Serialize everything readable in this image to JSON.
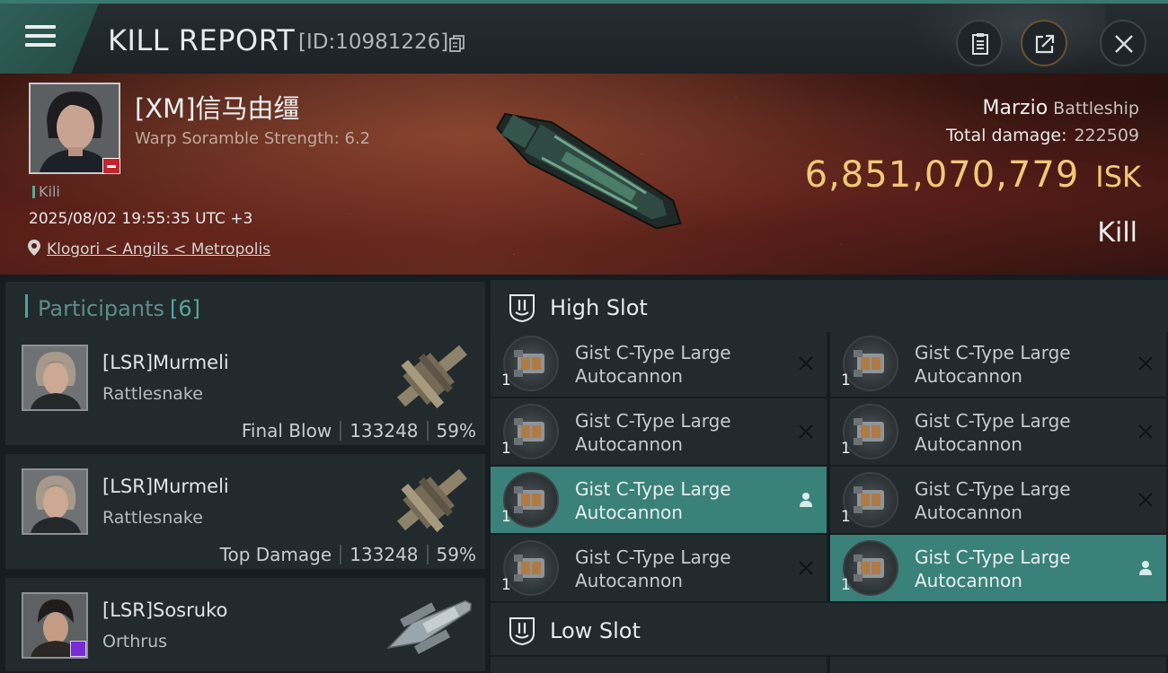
{
  "header": {
    "title": "KILL REPORT",
    "report_id": "[ID:10981226]",
    "icons": {
      "menu": "hamburger-menu-icon",
      "copy": "copy-icon",
      "report": "clipboard-icon",
      "share": "share-icon",
      "close": "close-icon"
    }
  },
  "victim": {
    "name": "[XM]信马由缰",
    "scramble": "Warp Soramble Strength: 6.2",
    "kill_tag": "Kili",
    "datetime": "2025/08/02 19:55:35 UTC +3",
    "location": "Klogori < Angils < Metropolis",
    "ship_name": "Marzio",
    "ship_class": "Battleship",
    "total_damage_label": "Total damage:",
    "total_damage": "222509",
    "isk_value": "6,851,070,779",
    "isk_unit": "ISK",
    "result": "Kill"
  },
  "participants": {
    "label": "Participants",
    "count": "[6]",
    "items": [
      {
        "name": "[LSR]Murmeli",
        "ship": "Rattlesnake",
        "role": "Final Blow",
        "damage": "133248",
        "percent": "59%"
      },
      {
        "name": "[LSR]Murmeli",
        "ship": "Rattlesnake",
        "role": "Top Damage",
        "damage": "133248",
        "percent": "59%"
      },
      {
        "name": "[LSR]Sosruko",
        "ship": "Orthrus",
        "role": "",
        "damage": "",
        "percent": ""
      }
    ]
  },
  "fitting": {
    "high_slot_label": "High Slot",
    "low_slot_label": "Low Slot",
    "high_slot_modules": [
      {
        "name": "Gist C-Type Large Autocannon",
        "qty": "1",
        "status": "destroyed",
        "flag_icon": "close-icon"
      },
      {
        "name": "Gist C-Type Large Autocannon",
        "qty": "1",
        "status": "destroyed",
        "flag_icon": "close-icon"
      },
      {
        "name": "Gist C-Type Large Autocannon",
        "qty": "1",
        "status": "destroyed",
        "flag_icon": "close-icon"
      },
      {
        "name": "Gist C-Type Large Autocannon",
        "qty": "1",
        "status": "destroyed",
        "flag_icon": "close-icon"
      },
      {
        "name": "Gist C-Type Large Autocannon",
        "qty": "1",
        "status": "dropped",
        "flag_icon": "person-icon"
      },
      {
        "name": "Gist C-Type Large Autocannon",
        "qty": "1",
        "status": "destroyed",
        "flag_icon": "close-icon"
      },
      {
        "name": "Gist C-Type Large Autocannon",
        "qty": "1",
        "status": "destroyed",
        "flag_icon": "close-icon"
      },
      {
        "name": "Gist C-Type Large Autocannon",
        "qty": "1",
        "status": "dropped",
        "flag_icon": "person-icon"
      }
    ]
  },
  "colors": {
    "accent_teal": "#3a8179",
    "isk_gold": "#f1c978",
    "banner_red": "#5a2a1f"
  }
}
